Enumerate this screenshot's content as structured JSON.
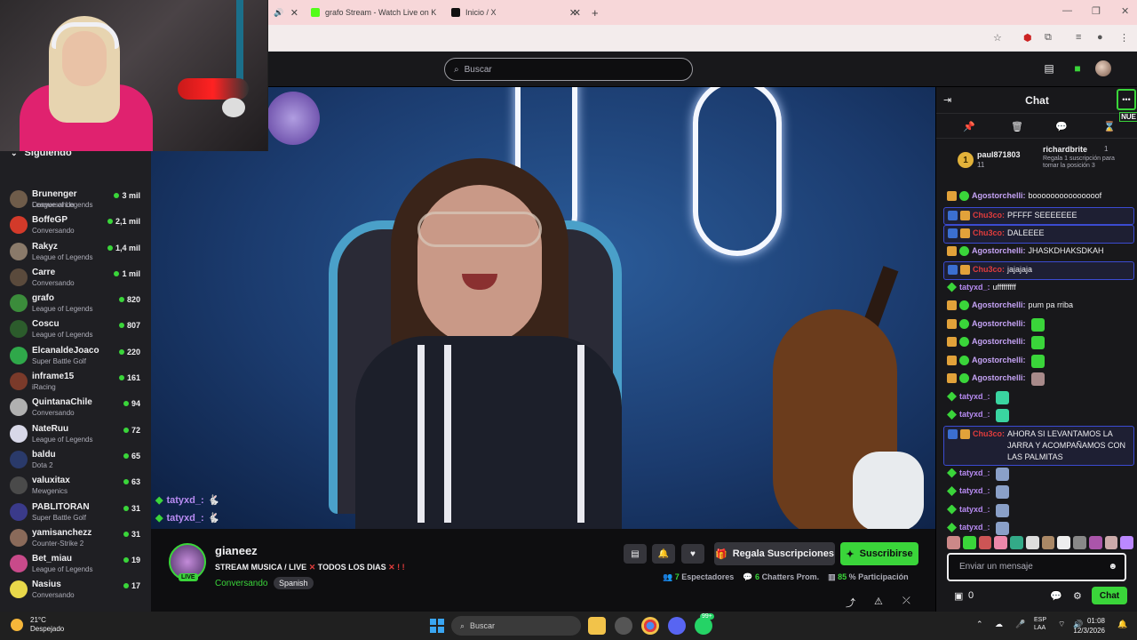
{
  "browser": {
    "tabs": [
      {
        "label": "",
        "icon": "speaker-icon"
      },
      {
        "label": "grafo Stream - Watch Live on K",
        "icon": "kick-icon"
      },
      {
        "label": "Inicio / X",
        "icon": "x-icon"
      }
    ],
    "new_tab": "+"
  },
  "topnav": {
    "search_placeholder": "Buscar"
  },
  "sidebar": {
    "header": "Siguiendo",
    "partial_item_game": "League of Legends",
    "items": [
      {
        "name": "Brunenger",
        "game": "Conversando",
        "count": "3 mil",
        "color": "#6f5c4a"
      },
      {
        "name": "BoffeGP",
        "game": "Conversando",
        "count": "2,1 mil",
        "color": "#d33a2a"
      },
      {
        "name": "Rakyz",
        "game": "League of Legends",
        "count": "1,4 mil",
        "color": "#8a7a6a"
      },
      {
        "name": "Carre",
        "game": "Conversando",
        "count": "1 mil",
        "color": "#5a4a3c"
      },
      {
        "name": "grafo",
        "game": "League of Legends",
        "count": "820",
        "color": "#3b8c3b"
      },
      {
        "name": "Coscu",
        "game": "League of Legends",
        "count": "807",
        "color": "#2c5c2c"
      },
      {
        "name": "ElcanaldeJoaco",
        "game": "Super Battle Golf",
        "count": "220",
        "color": "#2fa84a"
      },
      {
        "name": "inframe15",
        "game": "iRacing",
        "count": "161",
        "color": "#7a3a2a"
      },
      {
        "name": "QuintanaChile",
        "game": "Conversando",
        "count": "94",
        "color": "#b0b0b0"
      },
      {
        "name": "NateRuu",
        "game": "League of Legends",
        "count": "72",
        "color": "#d8d8e8"
      },
      {
        "name": "baldu",
        "game": "Dota 2",
        "count": "65",
        "color": "#2a3a6a"
      },
      {
        "name": "valuxitax",
        "game": "Mewgenics",
        "count": "63",
        "color": "#4a4a4a"
      },
      {
        "name": "PABLITORAN",
        "game": "Super Battle Golf",
        "count": "31",
        "color": "#3a3a8a"
      },
      {
        "name": "yamisanchezz",
        "game": "Counter-Strike 2",
        "count": "31",
        "color": "#8a6a5a"
      },
      {
        "name": "Bet_miau",
        "game": "League of Legends",
        "count": "19",
        "color": "#c84a8a"
      },
      {
        "name": "Nasius",
        "game": "Conversando",
        "count": "17",
        "color": "#e8d84a"
      }
    ]
  },
  "video": {
    "overlay_chat": [
      {
        "user": "tatyxd_:"
      },
      {
        "user": "tatyxd_:"
      }
    ]
  },
  "channel": {
    "name": "gianeez",
    "live_badge": "LIVE",
    "title_a": "STREAM MUSICA / LIVE",
    "title_b": "TODOS LOS DIAS",
    "category": "Conversando",
    "tag": "Spanish",
    "gift_label": "Regala Suscripciones",
    "subscribe_label": "Suscribirse",
    "viewers": "7",
    "viewers_label": "Espectadores",
    "chatters": "6",
    "chatters_label": "Chatters Prom.",
    "participation": "85",
    "participation_label": "% Participación"
  },
  "chat": {
    "title": "Chat",
    "badge_new": "NUE",
    "leaderboard": {
      "rank": "1",
      "user": "paul871803",
      "value": "11",
      "right_user": "richardbrite",
      "right_value": "1",
      "note": "Regala 1 suscripción para tomar la posición 3"
    },
    "messages": [
      {
        "user": "Agostorchelli:",
        "text": "booooooooooooooof",
        "color": "#c5a3f5",
        "hl": false
      },
      {
        "user": "Chu3co:",
        "text": "PFFFF SEEEEEEE",
        "color": "#e03c3c",
        "hl": true
      },
      {
        "user": "Chu3co:",
        "text": "DALEEEE",
        "color": "#e03c3c",
        "hl": true
      },
      {
        "user": "Agostorchelli:",
        "text": "JHASKDHAKSDKAH",
        "color": "#c5a3f5",
        "hl": false
      },
      {
        "user": "Chu3co:",
        "text": "jajajaja",
        "color": "#e03c3c",
        "hl": true
      },
      {
        "user": "tatyxd_:",
        "text": "ufffffffff",
        "color": "#b78bf2",
        "hl": false
      },
      {
        "user": "Agostorchelli:",
        "text": "pum pa rriba",
        "color": "#c5a3f5",
        "hl": false
      },
      {
        "user": "Agostorchelli:",
        "text": "",
        "color": "#c5a3f5",
        "hl": false,
        "emote": "#3ad53a"
      },
      {
        "user": "Agostorchelli:",
        "text": "",
        "color": "#c5a3f5",
        "hl": false,
        "emote": "#3ad53a"
      },
      {
        "user": "Agostorchelli:",
        "text": "",
        "color": "#c5a3f5",
        "hl": false,
        "emote": "#3ad53a"
      },
      {
        "user": "Agostorchelli:",
        "text": "",
        "color": "#c5a3f5",
        "hl": false,
        "emote": "#a88a8a"
      },
      {
        "user": "tatyxd_:",
        "text": "",
        "color": "#b78bf2",
        "hl": false,
        "emote": "#3ad5a0"
      },
      {
        "user": "tatyxd_:",
        "text": "",
        "color": "#b78bf2",
        "hl": false,
        "emote": "#3ad5a0"
      },
      {
        "user": "Chu3co:",
        "text": "AHORA SI LEVANTAMOS LA JARRA Y ACOMPAÑAMOS CON LAS PALMITAS",
        "color": "#e03c3c",
        "hl": true
      },
      {
        "user": "tatyxd_:",
        "text": "",
        "color": "#b78bf2",
        "hl": false,
        "emote": "#8aa0c8"
      },
      {
        "user": "tatyxd_:",
        "text": "",
        "color": "#b78bf2",
        "hl": false,
        "emote": "#8aa0c8"
      },
      {
        "user": "tatyxd_:",
        "text": "",
        "color": "#b78bf2",
        "hl": false,
        "emote": "#8aa0c8"
      },
      {
        "user": "tatyxd_:",
        "text": "",
        "color": "#b78bf2",
        "hl": false,
        "emote": "#8aa0c8"
      }
    ],
    "input_placeholder": "Enviar un mensaje",
    "points": "0",
    "send_label": "Chat"
  },
  "taskbar": {
    "temp": "21°C",
    "weather": "Despejado",
    "search": "Buscar",
    "lang_a": "ESP",
    "lang_b": "LAA",
    "time": "01:08",
    "date": "12/3/2026",
    "notif": "99+"
  }
}
